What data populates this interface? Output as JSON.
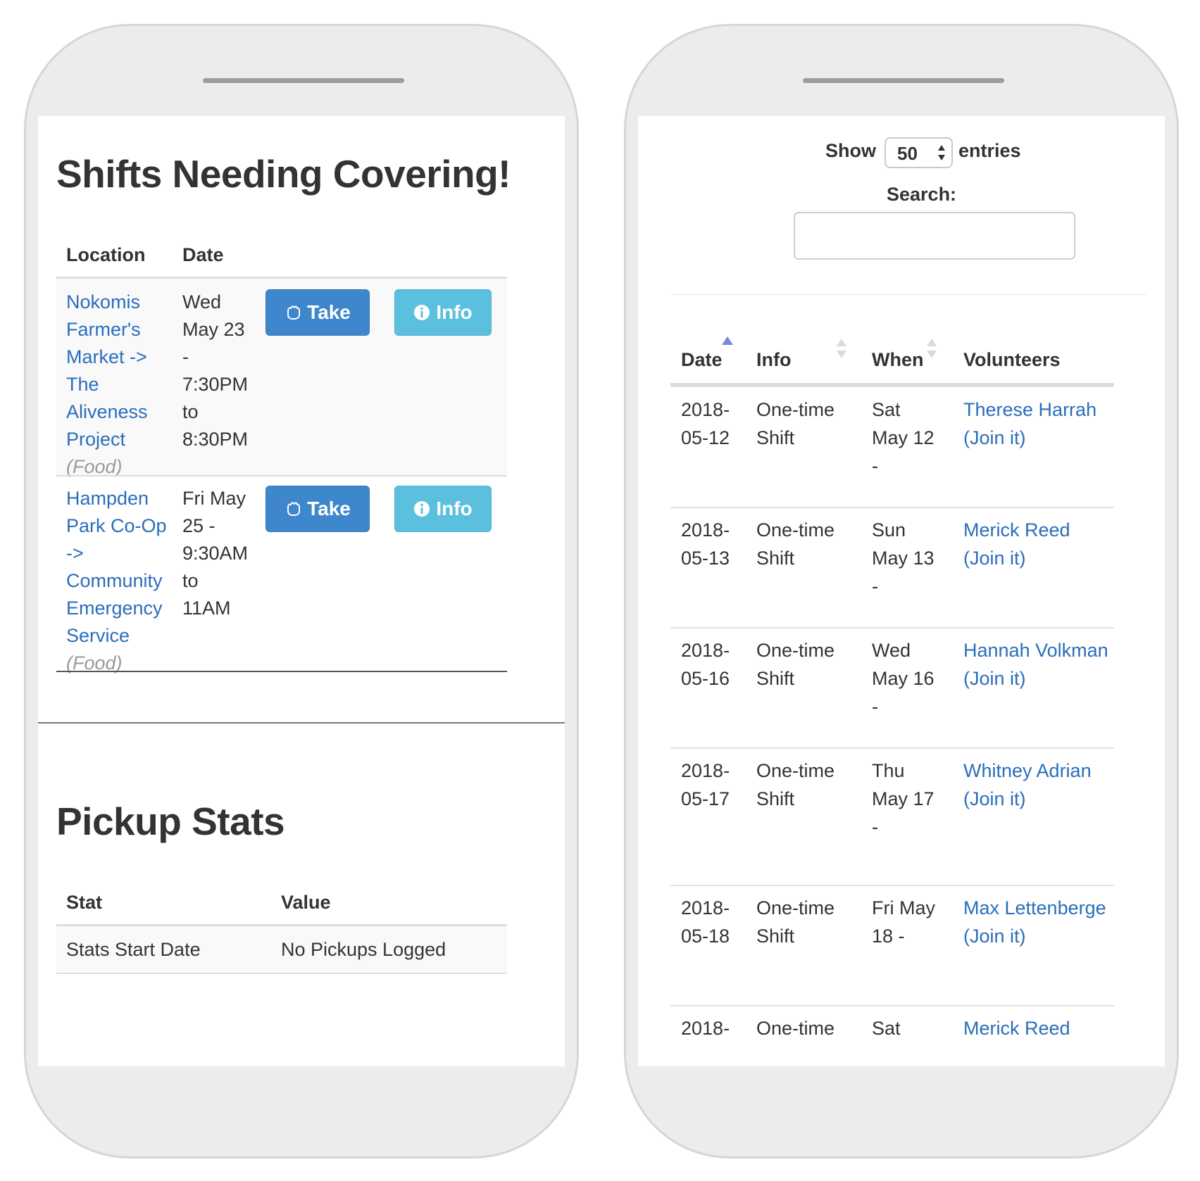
{
  "left_screen": {
    "shifts_title": "Shifts Needing Covering!",
    "shifts_table": {
      "headers": [
        "Location",
        "Date"
      ],
      "rows": [
        {
          "location_lines": [
            "Nokomis",
            "Farmer's",
            "Market ->",
            "The",
            "Aliveness",
            "Project"
          ],
          "category": "(Food)",
          "date_lines": [
            "Wed",
            "May 23",
            "-",
            "7:30PM",
            "to",
            "8:30PM"
          ],
          "take_label": "Take",
          "info_label": "Info"
        },
        {
          "location_lines": [
            "Hampden",
            "Park Co-Op",
            "->",
            "Community",
            "Emergency",
            "Service"
          ],
          "category": "(Food)",
          "date_lines": [
            "Fri May",
            "25 -",
            "9:30AM",
            "to",
            "11AM"
          ],
          "take_label": "Take",
          "info_label": "Info"
        }
      ]
    },
    "stats_title": "Pickup Stats",
    "stats_table": {
      "headers": [
        "Stat",
        "Value"
      ],
      "rows": [
        {
          "stat": "Stats Start Date",
          "value": "No Pickups Logged"
        }
      ]
    }
  },
  "right_screen": {
    "show_label": "Show",
    "entries_select_value": "50",
    "entries_label": "entries",
    "search_label": "Search:",
    "search_value": "",
    "table": {
      "headers": [
        "Date",
        "Info",
        "When",
        "Volunteers"
      ],
      "rows": [
        {
          "date_lines": [
            "2018-",
            "05-12"
          ],
          "info_lines": [
            "One-time",
            "Shift"
          ],
          "when_lines": [
            "Sat",
            "May 12",
            "-"
          ],
          "volunteer": "Therese Harrah",
          "join": "(Join it)"
        },
        {
          "date_lines": [
            "2018-",
            "05-13"
          ],
          "info_lines": [
            "One-time",
            "Shift"
          ],
          "when_lines": [
            "Sun",
            "May 13",
            "-"
          ],
          "volunteer": "Merick Reed",
          "join": "(Join it)"
        },
        {
          "date_lines": [
            "2018-",
            "05-16"
          ],
          "info_lines": [
            "One-time",
            "Shift"
          ],
          "when_lines": [
            "Wed",
            "May 16",
            "-"
          ],
          "volunteer": "Hannah Volkman",
          "join": "(Join it)"
        },
        {
          "date_lines": [
            "2018-",
            "05-17"
          ],
          "info_lines": [
            "One-time",
            "Shift"
          ],
          "when_lines": [
            "Thu",
            "May 17",
            "-"
          ],
          "volunteer": "Whitney Adrian",
          "join": "(Join it)"
        },
        {
          "date_lines": [
            "2018-",
            "05-18"
          ],
          "info_lines": [
            "One-time",
            "Shift"
          ],
          "when_lines": [
            "Fri May",
            "18 -"
          ],
          "volunteer": "Max Lettenberge",
          "join": "(Join it)"
        },
        {
          "date_lines": [
            "2018-"
          ],
          "info_lines": [
            "One-time"
          ],
          "when_lines": [
            "Sat"
          ],
          "volunteer": "Merick Reed",
          "join": ""
        }
      ]
    }
  },
  "colors": {
    "link": "#2a6ebb",
    "take_button": "#3f87cc",
    "info_button": "#5bc0de",
    "phone_body": "#eeebeb",
    "sort_active_arrow": "#7b88d6"
  },
  "icons": [
    "hand-icon",
    "info-circle-icon",
    "sort-asc-icon",
    "sort-both-icon",
    "select-arrows-icon"
  ]
}
